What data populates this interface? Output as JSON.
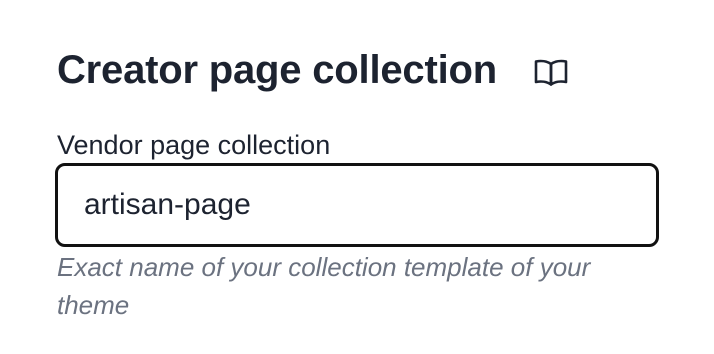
{
  "section": {
    "title": "Creator page collection",
    "title_icon": "book-open-icon"
  },
  "field": {
    "label": "Vendor page collection",
    "value": "artisan-page",
    "help_text": "Exact name of your collection template of your theme"
  }
}
